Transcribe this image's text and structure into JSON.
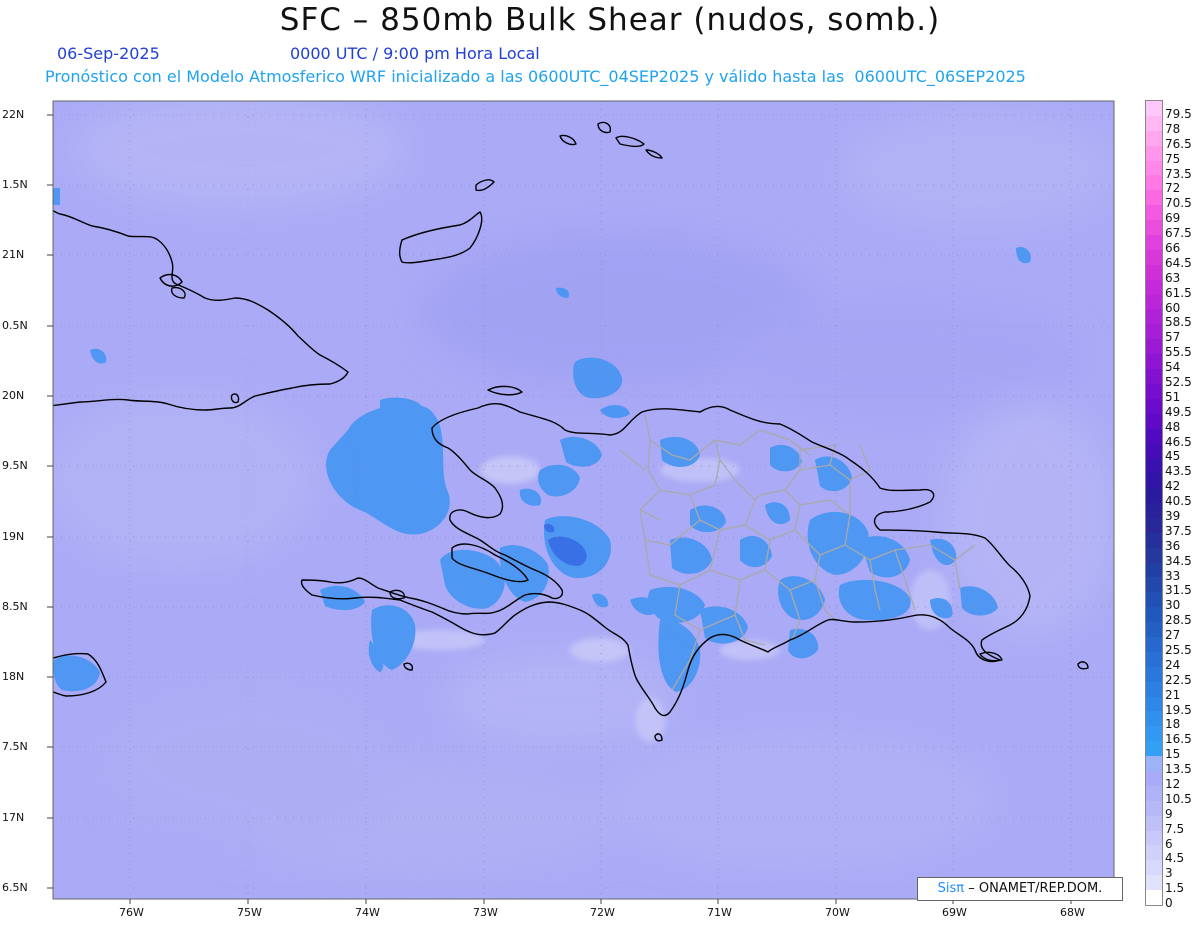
{
  "header": {
    "title": "SFC – 850mb Bulk Shear (nudos, somb.)",
    "date": "06-Sep-2025",
    "valid_time": "0000 UTC / 9:00 pm Hora Local",
    "description": "Pronóstico con el Modelo Atmosferico WRF inicializado a las 0600UTC_04SEP2025 y válido hasta las  0600UTC_06SEP2025"
  },
  "map": {
    "latitude_labels": [
      "22N",
      "1.5N",
      "21N",
      "0.5N",
      "20N",
      "9.5N",
      "19N",
      "8.5N",
      "18N",
      "7.5N",
      "17N",
      "6.5N"
    ],
    "longitude_labels": [
      "76W",
      "75W",
      "74W",
      "73W",
      "72W",
      "71W",
      "70W",
      "69W",
      "68W"
    ],
    "credit_logo": "Sisπ",
    "credit_text": "– ONAMET/REP.DOM.",
    "colors": {
      "background_shade": "#aaaaf6",
      "land_outline": "#000000",
      "province_border": "#a9a9a9",
      "shear_15_knots": "#4a96f2",
      "shear_20_knots": "#3a70e6"
    }
  },
  "colorbar": {
    "labels": [
      "79.5",
      "78",
      "76.5",
      "75",
      "73.5",
      "72",
      "70.5",
      "69",
      "67.5",
      "66",
      "64.5",
      "63",
      "61.5",
      "60",
      "58.5",
      "57",
      "55.5",
      "54",
      "52.5",
      "51",
      "49.5",
      "48",
      "46.5",
      "45",
      "43.5",
      "42",
      "40.5",
      "39",
      "37.5",
      "36",
      "34.5",
      "33",
      "31.5",
      "30",
      "28.5",
      "27",
      "25.5",
      "24",
      "22.5",
      "21",
      "19.5",
      "18",
      "16.5",
      "15",
      "13.5",
      "12",
      "10.5",
      "9",
      "7.5",
      "6",
      "4.5",
      "3",
      "1.5",
      "0"
    ],
    "colors": [
      "#ffc8f8",
      "#ffb8f4",
      "#ffa8f0",
      "#ff98ec",
      "#ff88e8",
      "#ff78e4",
      "#fa68e2",
      "#f258e0",
      "#ea4cde",
      "#e040dc",
      "#d838da",
      "#ce30d8",
      "#c42ad8",
      "#ba26d8",
      "#b022d8",
      "#a61ed6",
      "#9a1ad4",
      "#8e16d2",
      "#8212d0",
      "#760ece",
      "#6a0cca",
      "#5e0ac6",
      "#520ac0",
      "#460cb8",
      "#3a10ae",
      "#3214a6",
      "#2c1a9e",
      "#2a209a",
      "#282898",
      "#26309a",
      "#24389e",
      "#2240a4",
      "#2248ac",
      "#2250b4",
      "#2258bc",
      "#2460c4",
      "#2668cc",
      "#2870d4",
      "#2a78dc",
      "#2c80e4",
      "#2e88ea",
      "#3090ee",
      "#3298f2",
      "#34a0f4",
      "#9eb2f8",
      "#a8acf8",
      "#b0b2f8",
      "#b8b8f8",
      "#c0c0f8",
      "#c8c8fa",
      "#d0d0fa",
      "#d8d8fc",
      "#e2e2fc",
      "#ffffff"
    ]
  }
}
